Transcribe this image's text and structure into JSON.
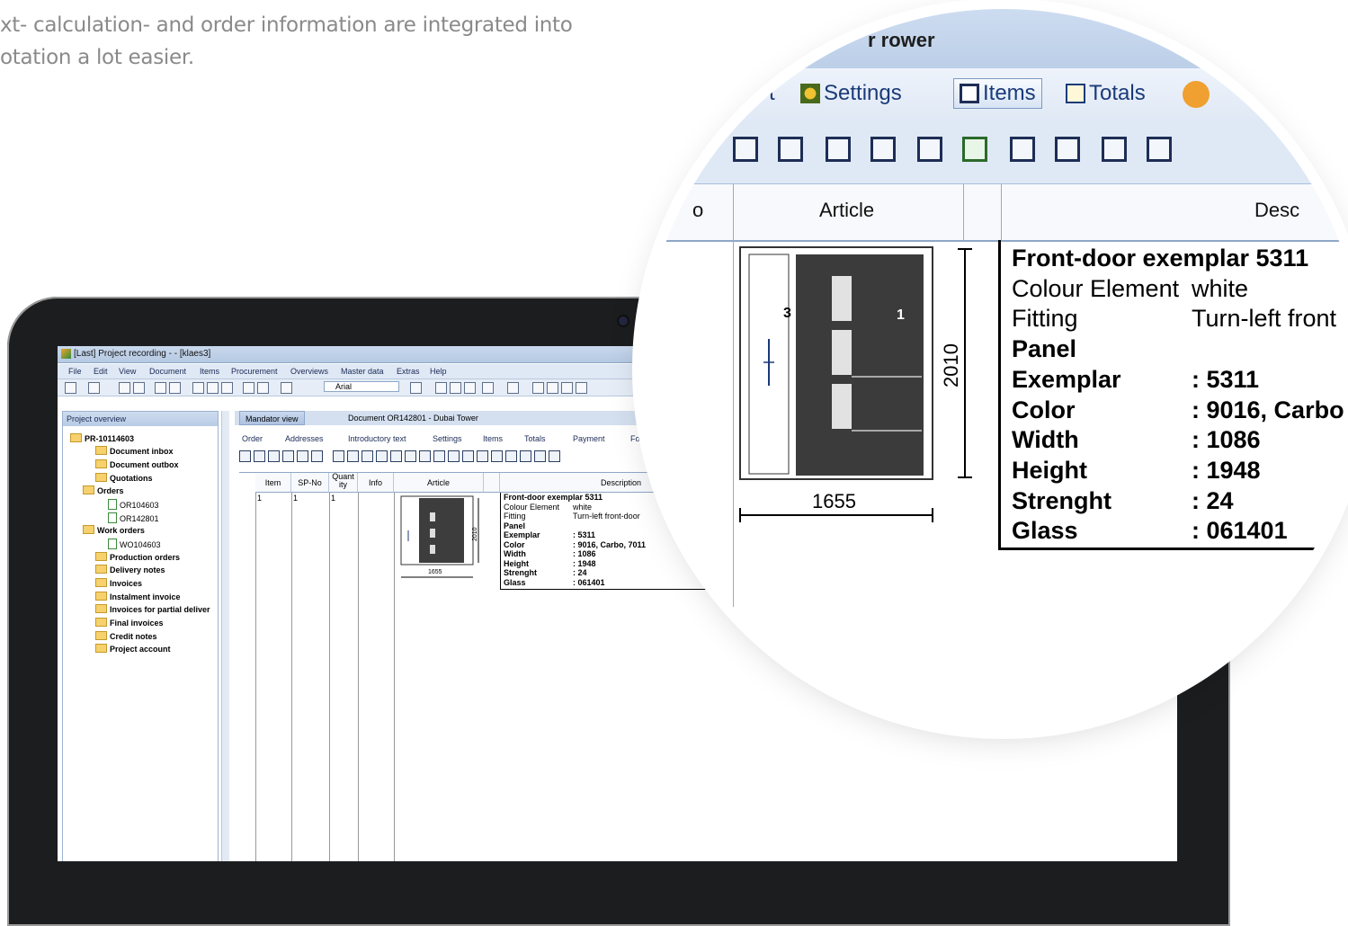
{
  "intro": {
    "line1": "xt- calculation- and order information are integrated into",
    "line2": "otation a lot easier."
  },
  "app": {
    "window_title": "[Last] Project recording - - [klaes3]",
    "menu": [
      "File",
      "Edit",
      "View",
      "Document",
      "Items",
      "Procurement",
      "Overviews",
      "Master data",
      "Extras",
      "Help"
    ],
    "font_name": "Arial",
    "project_overview_label": "Project overview",
    "tree": [
      {
        "label": "PR-10114603",
        "bold": true
      },
      {
        "label": "Document inbox",
        "bold": true
      },
      {
        "label": "Document outbox",
        "bold": true
      },
      {
        "label": "Quotations",
        "bold": true
      },
      {
        "label": "Orders",
        "bold": true
      },
      {
        "label": "OR104603",
        "bold": false
      },
      {
        "label": "OR142801",
        "bold": false
      },
      {
        "label": "Work orders",
        "bold": true
      },
      {
        "label": "WO104603",
        "bold": false
      },
      {
        "label": "Production orders",
        "bold": true
      },
      {
        "label": "Delivery notes",
        "bold": true
      },
      {
        "label": "Invoices",
        "bold": true
      },
      {
        "label": "Instalment invoice",
        "bold": true
      },
      {
        "label": "Invoices for partial deliver",
        "bold": true
      },
      {
        "label": "Final invoices",
        "bold": true
      },
      {
        "label": "Credit notes",
        "bold": true
      },
      {
        "label": "Project account",
        "bold": true
      }
    ],
    "tabs": {
      "mandator": "Mandator view",
      "document": "Document OR142801 - Dubai Tower"
    },
    "subtabs": [
      "Order",
      "Addresses",
      "Introductory text",
      "Settings",
      "Items",
      "Totals",
      "Payment",
      "Fo"
    ],
    "columns": {
      "item": "Item",
      "spno": "SP-No",
      "quantity": "Quant ity",
      "info": "Info",
      "article": "Article",
      "description": "Description"
    },
    "row": {
      "item": "1",
      "spno": "1",
      "quantity": "1"
    },
    "small_desc": {
      "title": "Front-door exemplar 5311",
      "colour_label": "Colour Element",
      "colour_value": "white",
      "fitting_label": "Fitting",
      "fitting_value": "Turn-left front-door",
      "panel": "Panel",
      "exemplar_label": "Exemplar",
      "exemplar_value": ": 5311",
      "color_label": "Color",
      "color_value": ": 9016, Carbo, 7011",
      "width_label": "Width",
      "width_value": ": 1086",
      "height_label": "Height",
      "height_value": ": 1948",
      "strenght_label": "Strenght",
      "strenght_value": ": 24",
      "glass_label": "Glass",
      "glass_value": ": 061401"
    },
    "dim_width": "1655",
    "dim_height": "2010"
  },
  "magnifier": {
    "title_fragment": "r rower",
    "tab_left_fragment": "t",
    "tab_settings": "Settings",
    "tab_items": "Items",
    "tab_totals": "Totals",
    "head_left": "o",
    "head_article": "Article",
    "head_desc": "Desc",
    "desc": {
      "title": "Front-door exemplar 5311",
      "colour_label": "Colour Element",
      "colour_value": "white",
      "fitting_label": "Fitting",
      "fitting_value": "Turn-left front",
      "panel": "Panel",
      "exemplar_label": "Exemplar",
      "exemplar_value": ": 5311",
      "color_label": "Color",
      "color_value": ": 9016, Carbo",
      "width_label": "Width",
      "width_value": ": 1086",
      "height_label": "Height",
      "height_value": ": 1948",
      "strenght_label": "Strenght",
      "strenght_value": ": 24",
      "glass_label": "Glass",
      "glass_value": ": 061401"
    },
    "dim_width": "1655",
    "dim_height": "2010",
    "label_1": "1",
    "label_3": "3"
  },
  "colors": {
    "laptop": "#1c1d1f",
    "ribbon": "#dfe8f5",
    "accent": "#1a3a78"
  }
}
